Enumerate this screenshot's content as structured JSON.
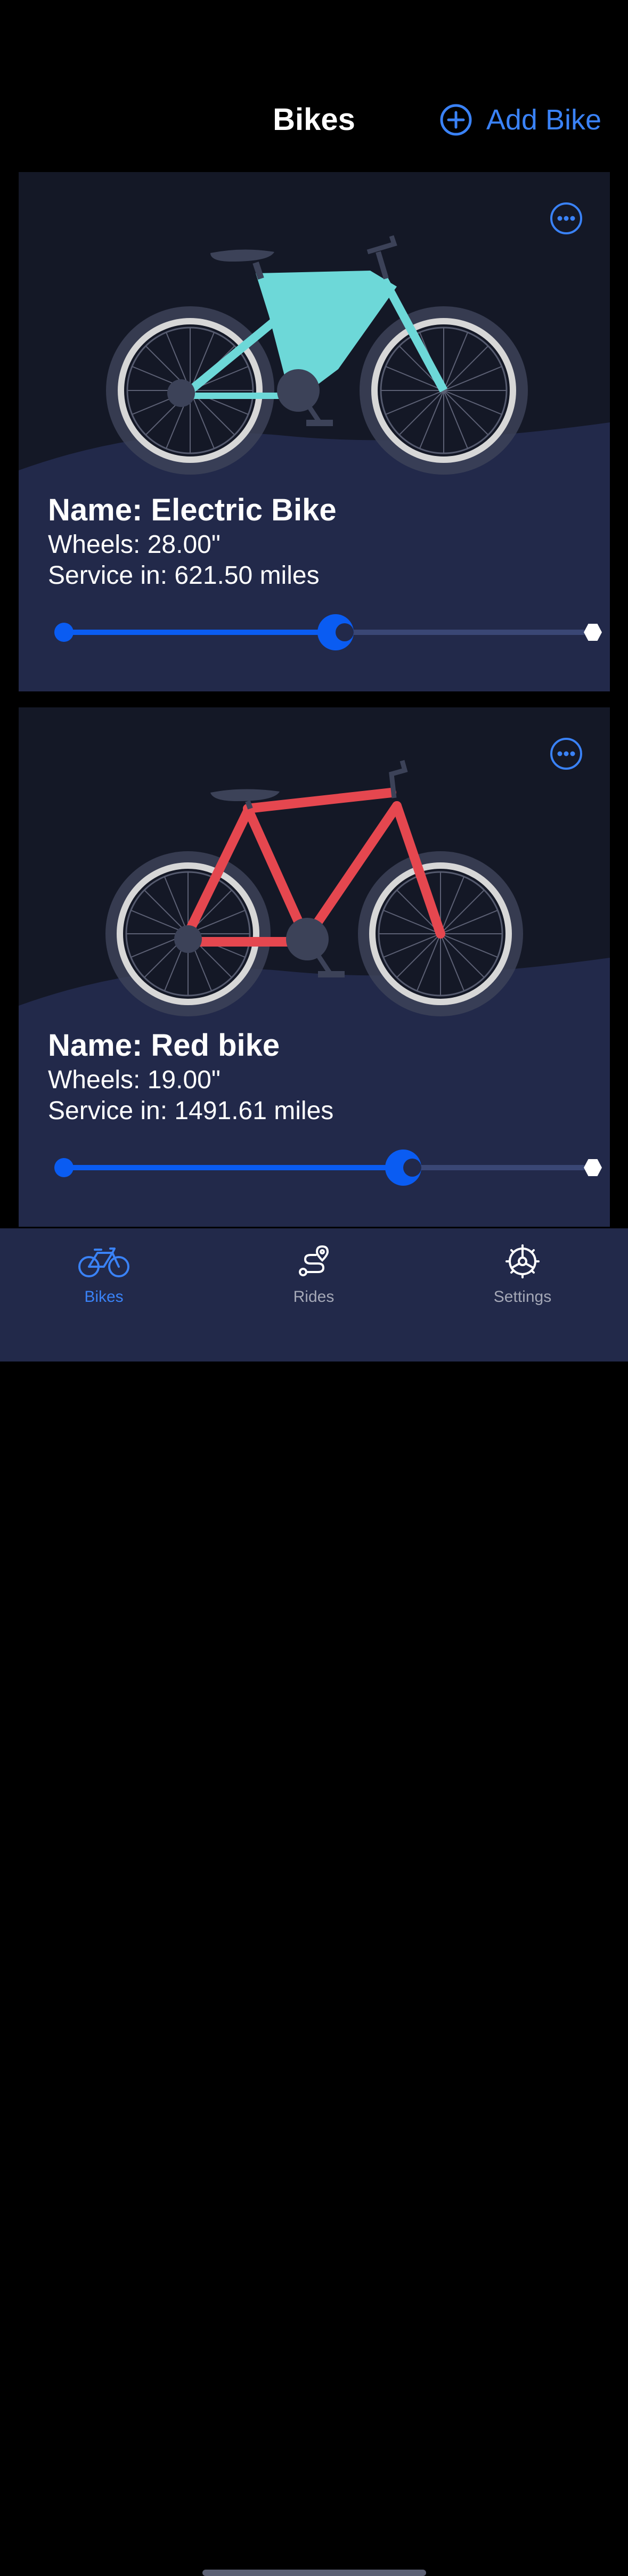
{
  "header": {
    "title": "Bikes",
    "add_label": "Add Bike",
    "accent_color": "#3a82f7"
  },
  "bikes": [
    {
      "name": "Name: Electric Bike",
      "wheels": "Wheels: 28.00\"",
      "service": "Service in: 621.50 miles",
      "frame_color": "#6dd8d8",
      "service_progress": 0.52,
      "illustration": "electric-bike-icon"
    },
    {
      "name": "Name: Red bike",
      "wheels": "Wheels: 19.00\"",
      "service": "Service in: 1491.61 miles",
      "frame_color": "#e5474f",
      "service_progress": 0.65,
      "illustration": "road-bike-icon"
    }
  ],
  "tabs": [
    {
      "label": "Bikes",
      "icon": "bicycle-icon",
      "active": true
    },
    {
      "label": "Rides",
      "icon": "route-icon",
      "active": false
    },
    {
      "label": "Settings",
      "icon": "gear-icon",
      "active": false
    }
  ],
  "colors": {
    "background": "#000000",
    "card": "#22294a",
    "slider_fill": "#0a5cf2",
    "slider_track": "#3a4775"
  }
}
